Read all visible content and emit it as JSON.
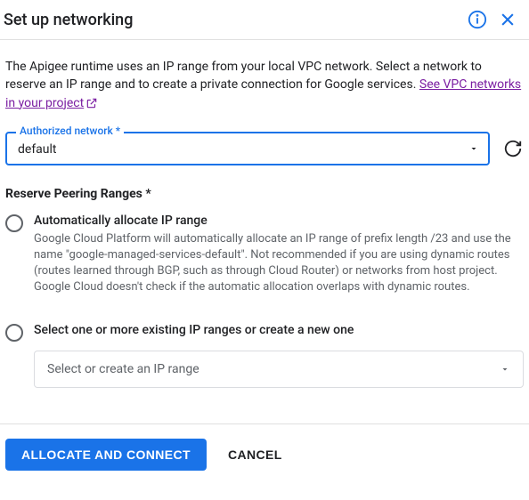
{
  "header": {
    "title": "Set up networking"
  },
  "description": {
    "text": "The Apigee runtime uses an IP range from your local VPC network. Select a network to reserve an IP range and to create a private connection for Google services. ",
    "link_text": "See VPC networks in your project"
  },
  "network_field": {
    "label": "Authorized network *",
    "value": "default"
  },
  "peering": {
    "section_label": "Reserve Peering Ranges *",
    "options": [
      {
        "title": "Automatically allocate IP range",
        "help": "Google Cloud Platform will automatically allocate an IP range of prefix length /23 and use the name \"google-managed-services-default\". Not recommended if you are using dynamic routes (routes learned through BGP, such as through Cloud Router) or networks from host project. Google Cloud doesn't check if the automatic allocation overlaps with dynamic routes."
      },
      {
        "title": "Select one or more existing IP ranges or create a new one",
        "help": ""
      }
    ],
    "ip_select_placeholder": "Select or create an IP range"
  },
  "footer": {
    "primary": "ALLOCATE AND CONNECT",
    "cancel": "CANCEL"
  }
}
